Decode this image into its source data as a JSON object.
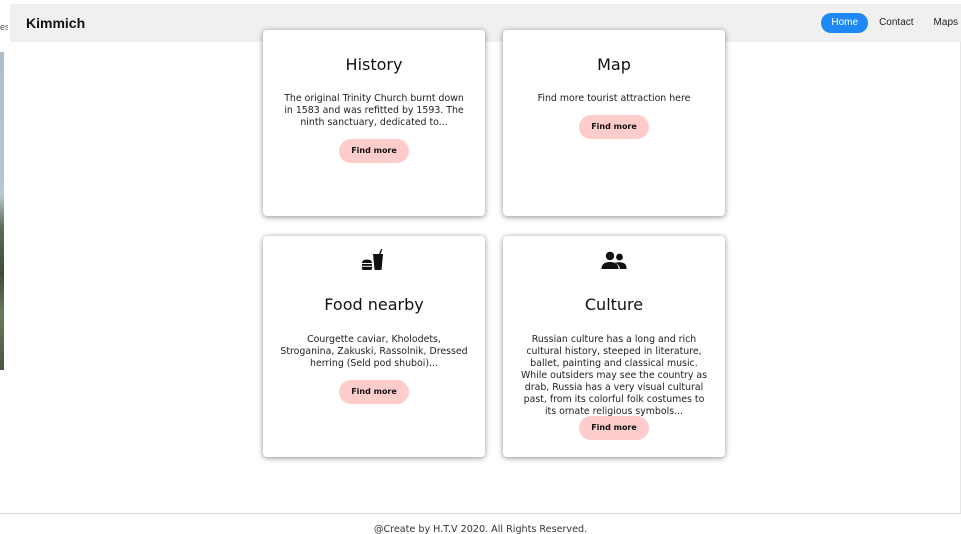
{
  "left_fragment": "es",
  "navbar": {
    "brand": "Kimmich",
    "items": [
      {
        "label": "Home",
        "active": true
      },
      {
        "label": "Contact",
        "active": false
      },
      {
        "label": "Maps",
        "active": false
      }
    ]
  },
  "cards": [
    {
      "title": "History",
      "description": "The original Trinity Church burnt down in 1583 and was refitted by 1593. The ninth sanctuary, dedicated to...",
      "button": "Find more"
    },
    {
      "title": "Map",
      "description": "Find more tourist attraction here",
      "button": "Find more"
    },
    {
      "title": "Food nearby",
      "icon": "fastfood-icon",
      "description": "Courgette caviar, Kholodets, Stroganina, Zakuski, Rassolnik, Dressed herring (Seld pod shuboi)...",
      "button": "Find more"
    },
    {
      "title": "Culture",
      "icon": "people-icon",
      "description": "Russian culture has a long and rich cultural history, steeped in literature, ballet, painting and classical music. While outsiders may see the country as drab, Russia has a very visual cultural past, from its colorful folk costumes to its ornate religious symbols...",
      "button": "Find more"
    }
  ],
  "footer": {
    "text": "@Create by H.T.V 2020. All Rights Reserved."
  },
  "colors": {
    "nav_active": "#1e88f5",
    "navbar_bg": "#f0f0f0",
    "button_bg": "#ffcccc"
  }
}
